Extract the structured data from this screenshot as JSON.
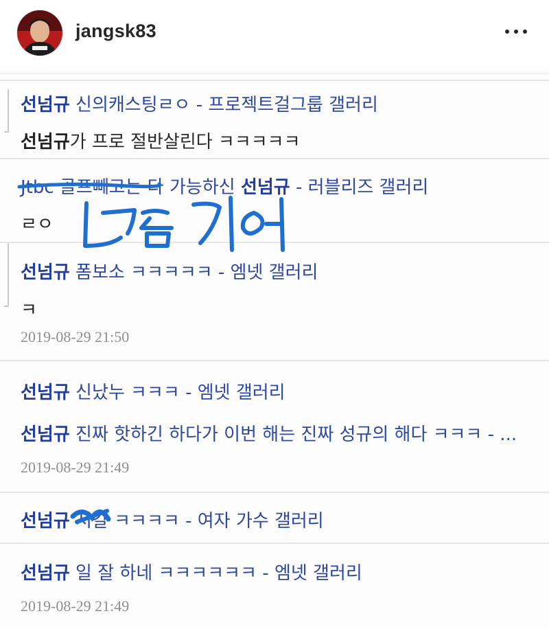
{
  "header": {
    "username": "jangsk83",
    "avatar_icon": "profile-photo",
    "more_icon": "more-dots-icon"
  },
  "results": [
    {
      "name": "선넘규",
      "title": " 신의캐스팅ㄹㅇ",
      "gallery": " - 프로젝트걸그룹 갤러리",
      "body": "가 프로 절반살린다 ㅋㅋㅋㅋㅋ",
      "body_prefix": "선넘규"
    },
    {
      "prefix": "Jtbc 골프빼고는 ",
      "prefix2": "다 가능하신 ",
      "name": "선넘규",
      "gallery": " - 러블리즈 갤러리",
      "body": "ㄹㅇ"
    },
    {
      "name": "선넘규",
      "title": " 폼보소 ㅋㅋㅋㅋㅋ",
      "gallery": " - 엠넷 갤러리",
      "body": "ㅋ",
      "date": "2019-08-29 21:50"
    },
    {
      "name": "선넘규",
      "title": " 신났누 ㅋㅋㅋ",
      "gallery": " - 엠넷 갤러리",
      "name2": "선넘규",
      "title2": " 진짜 핫하긴 하다가 이번 해는 진짜 성규의 해다 ㅋㅋㅋ - ...",
      "date": "2019-08-29 21:49"
    },
    {
      "name": "선넘규",
      "title": " 서갈 ㅋㅋㅋㅋ",
      "gallery": " - 여자 가수 갤러리"
    },
    {
      "name": "선넘규",
      "title": " 일 잘 하네 ㅋㅋㅋㅋㅋㅋ",
      "gallery": " - 엠넷 갤러리",
      "date": "2019-08-29 21:49"
    }
  ],
  "handwriting": {
    "text": "느금기어",
    "color": "#1f6fd0"
  }
}
